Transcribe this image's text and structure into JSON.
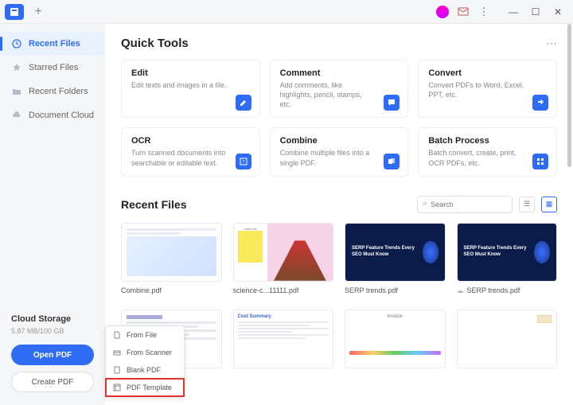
{
  "sidebar": {
    "items": [
      {
        "label": "Recent Files"
      },
      {
        "label": "Starred Files"
      },
      {
        "label": "Recent Folders"
      },
      {
        "label": "Document Cloud"
      }
    ],
    "cloud_title": "Cloud Storage",
    "cloud_usage": "5.87 MB/100 GB",
    "open_btn": "Open PDF",
    "create_btn": "Create PDF"
  },
  "quick_tools": {
    "title": "Quick Tools",
    "items": [
      {
        "name": "Edit",
        "desc": "Edit texts and images in a file."
      },
      {
        "name": "Comment",
        "desc": "Add comments, like highlights, pencil, stamps, etc."
      },
      {
        "name": "Convert",
        "desc": "Convert PDFs to Word, Excel, PPT, etc."
      },
      {
        "name": "OCR",
        "desc": "Turn scanned documents into searchable or editable text."
      },
      {
        "name": "Combine",
        "desc": "Combine multiple files into a single PDF."
      },
      {
        "name": "Batch Process",
        "desc": "Batch convert, create, print, OCR PDFs, etc."
      }
    ]
  },
  "recent_files": {
    "title": "Recent Files",
    "search_placeholder": "Search",
    "files": [
      {
        "name": "Combine.pdf"
      },
      {
        "name": "science-c...11111.pdf"
      },
      {
        "name": "SERP trends.pdf"
      },
      {
        "name": "SERP trends.pdf"
      },
      {
        "name": ""
      },
      {
        "name": ""
      },
      {
        "name": ""
      },
      {
        "name": ""
      }
    ],
    "serp_text": "SERP Feature Trends Every SEO Must Know"
  },
  "create_menu": {
    "items": [
      {
        "label": "From File"
      },
      {
        "label": "From Scanner"
      },
      {
        "label": "Blank PDF"
      },
      {
        "label": "PDF Template"
      }
    ]
  },
  "doc_label": "Cost Summary",
  "inv_label": "Invoice"
}
